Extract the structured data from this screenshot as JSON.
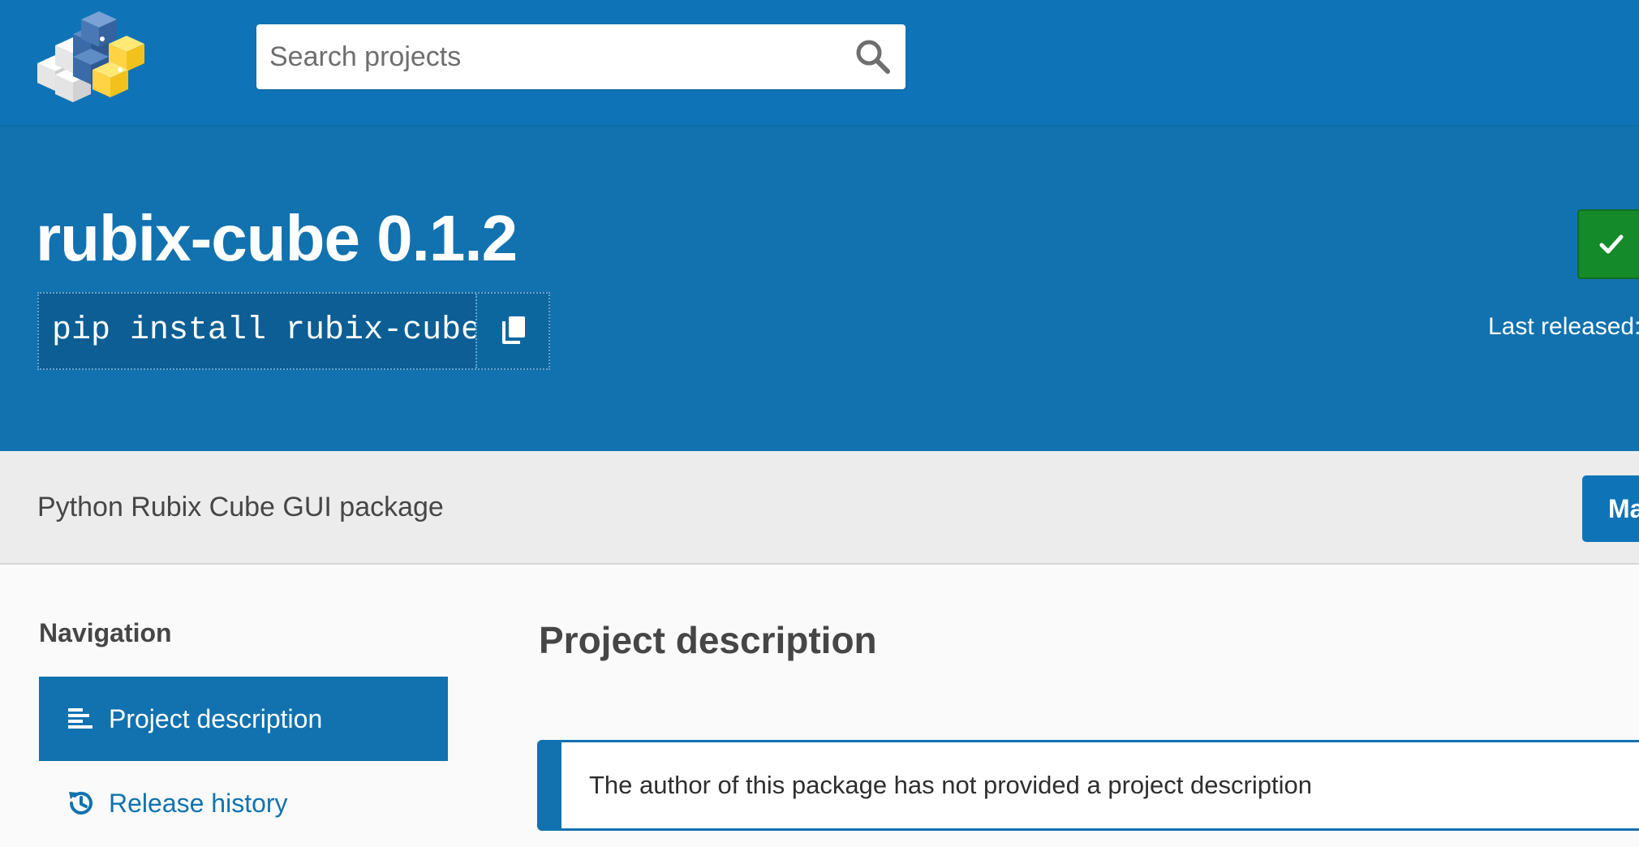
{
  "header": {
    "logo_alt": "PyPI",
    "search": {
      "placeholder": "Search projects",
      "value": ""
    }
  },
  "package": {
    "title": "rubix-cube 0.1.2",
    "install_command": "pip install rubix-cube",
    "last_released_label": "Last released:",
    "summary": "Python Rubix Cube GUI package",
    "maintainer_button_label": "Ma"
  },
  "navigation": {
    "heading": "Navigation",
    "items": [
      {
        "label": "Project description",
        "icon": "align-left-icon",
        "active": true
      },
      {
        "label": "Release history",
        "icon": "history-icon",
        "active": false
      }
    ]
  },
  "main": {
    "section_title": "Project description",
    "callout_text": "The author of this package has not provided a project description"
  },
  "colors": {
    "header_blue": "#0f74b7",
    "banner_blue": "#1172af",
    "success_green": "#158a2a",
    "summary_gray": "#ececec"
  }
}
